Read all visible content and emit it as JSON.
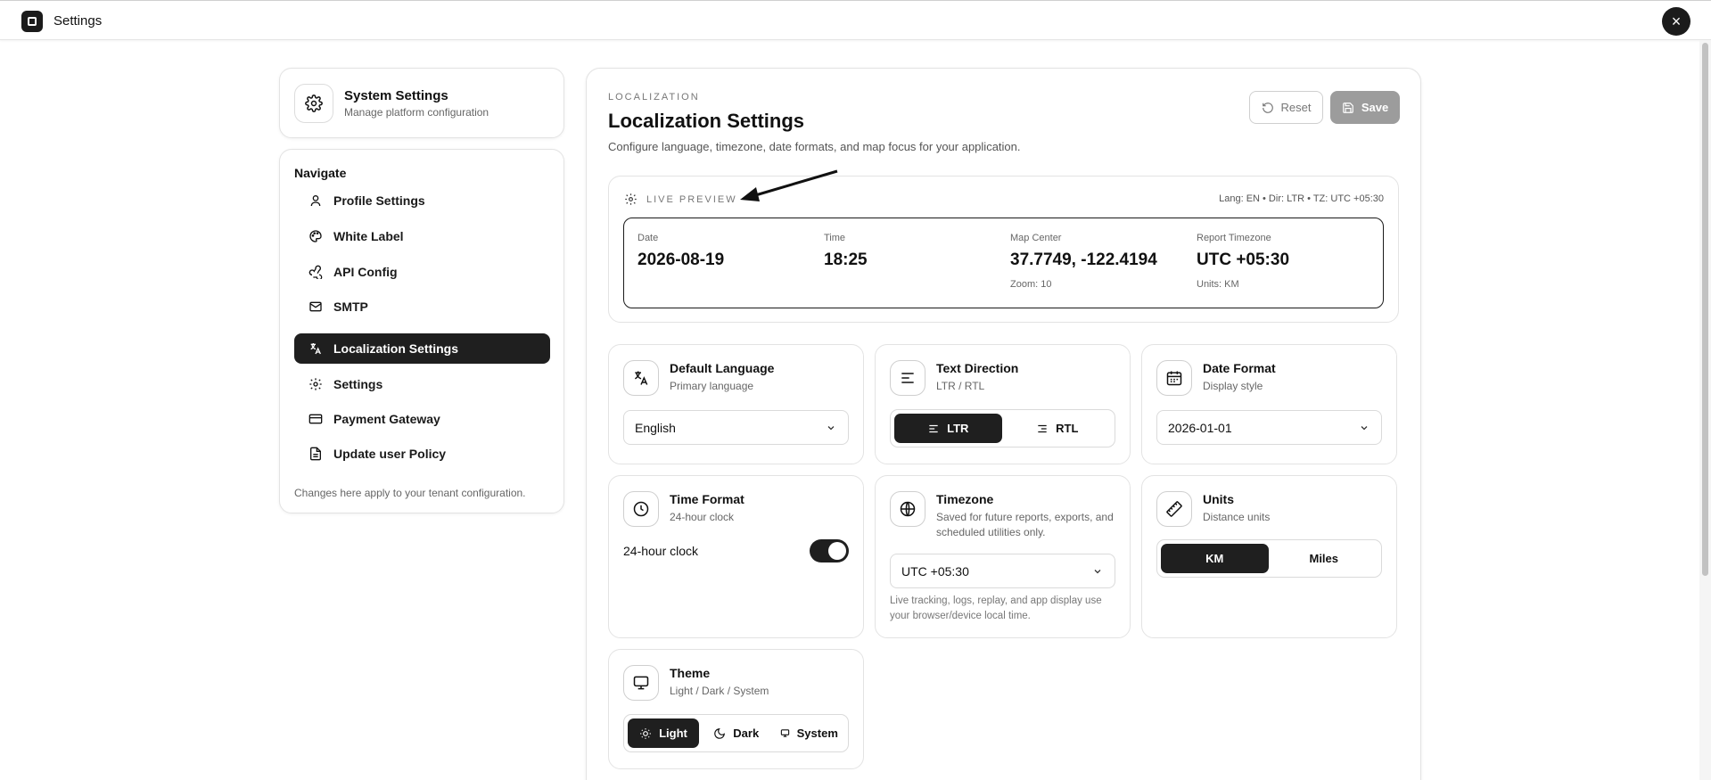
{
  "app": {
    "title": "Settings",
    "close_symbol": "×"
  },
  "sidebar": {
    "system": {
      "title": "System Settings",
      "subtitle": "Manage platform configuration"
    },
    "nav_heading": "Navigate",
    "items": [
      {
        "label": "Profile Settings",
        "icon": "user-icon"
      },
      {
        "label": "White Label",
        "icon": "palette-icon"
      },
      {
        "label": "API Config",
        "icon": "webhook-icon"
      },
      {
        "label": "SMTP",
        "icon": "mail-icon"
      },
      {
        "label": "Localization Settings",
        "icon": "languages-icon",
        "active": true
      },
      {
        "label": "Settings",
        "icon": "gear-icon"
      },
      {
        "label": "Payment Gateway",
        "icon": "credit-card-icon"
      },
      {
        "label": "Update user Policy",
        "icon": "document-icon"
      }
    ],
    "footer": "Changes here apply to your tenant configuration."
  },
  "main": {
    "eyebrow": "LOCALIZATION",
    "title": "Localization Settings",
    "subtitle": "Configure language, timezone, date formats, and map focus for your application.",
    "reset_label": "Reset",
    "save_label": "Save"
  },
  "preview": {
    "label": "LIVE PREVIEW",
    "meta": "Lang: EN • Dir: LTR • TZ: UTC +05:30",
    "date": {
      "label": "Date",
      "value": "2026-08-19"
    },
    "time": {
      "label": "Time",
      "value": "18:25"
    },
    "map": {
      "label": "Map Center",
      "value": "37.7749, -122.4194",
      "sub": "Zoom: 10"
    },
    "tz": {
      "label": "Report Timezone",
      "value": "UTC +05:30",
      "sub": "Units: KM"
    }
  },
  "settings": {
    "language": {
      "title": "Default Language",
      "subtitle": "Primary language",
      "value": "English"
    },
    "direction": {
      "title": "Text Direction",
      "subtitle": "LTR / RTL",
      "options": [
        "LTR",
        "RTL"
      ],
      "selected": "LTR"
    },
    "date_format": {
      "title": "Date Format",
      "subtitle": "Display style",
      "value": "2026-01-01"
    },
    "time_format": {
      "title": "Time Format",
      "subtitle": "24-hour clock",
      "toggle_label": "24-hour clock",
      "enabled": true
    },
    "timezone": {
      "title": "Timezone",
      "subtitle": "Saved for future reports, exports, and scheduled utilities only.",
      "value": "UTC +05:30",
      "note": "Live tracking, logs, replay, and app display use your browser/device local time."
    },
    "units": {
      "title": "Units",
      "subtitle": "Distance units",
      "options": [
        "KM",
        "Miles"
      ],
      "selected": "KM"
    },
    "theme": {
      "title": "Theme",
      "subtitle": "Light / Dark / System",
      "options": [
        "Light",
        "Dark",
        "System"
      ],
      "selected": "Light"
    }
  },
  "colors": {
    "accent": "#1f1f1f",
    "disabled": "#9c9c9c",
    "border": "#e3e3e3"
  }
}
